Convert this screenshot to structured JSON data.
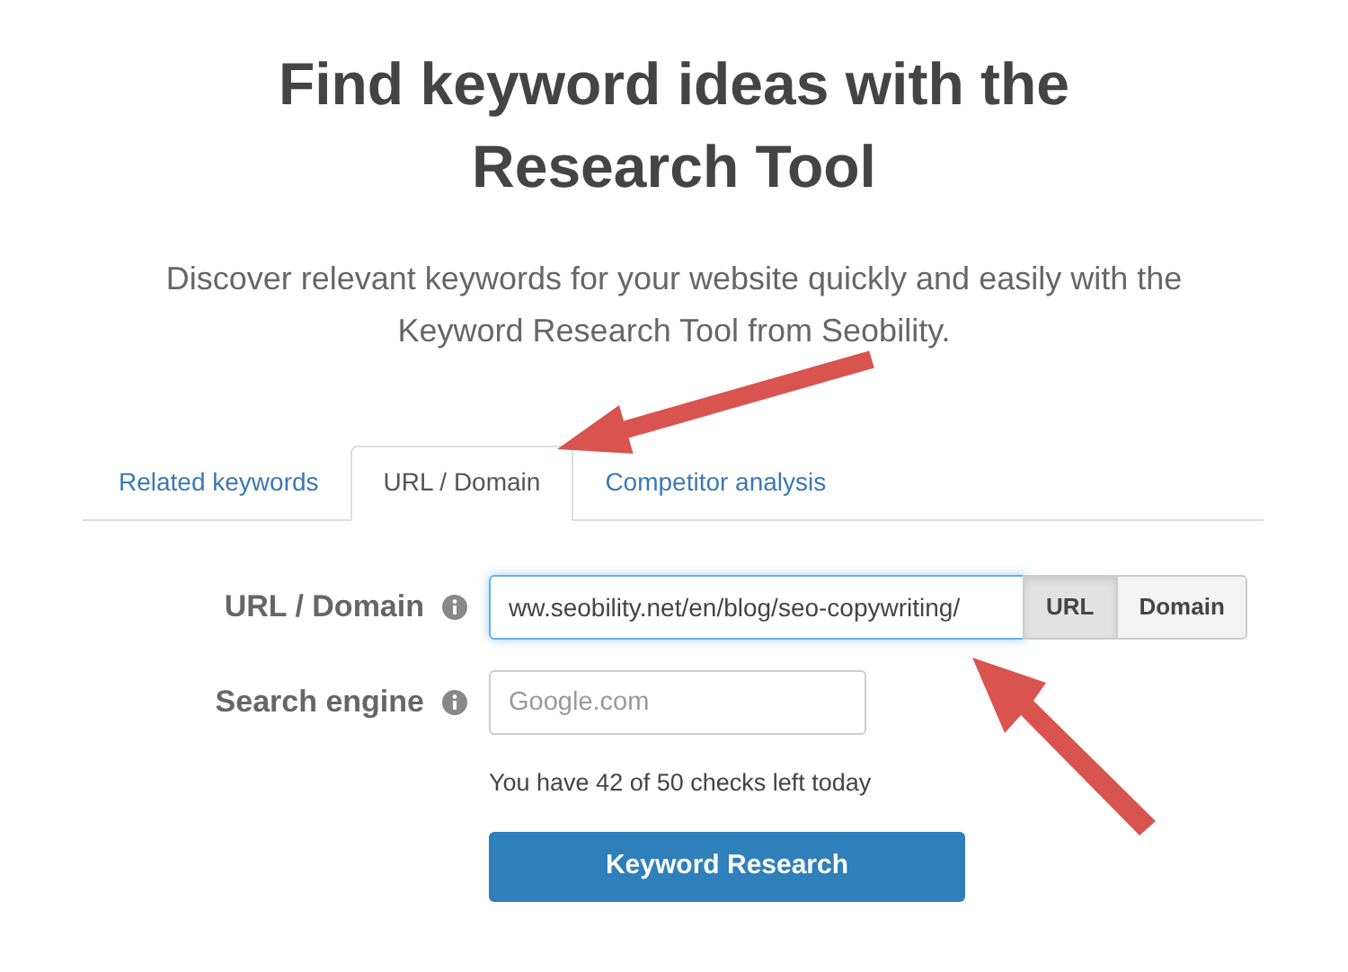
{
  "title": "Find keyword ideas with the Research Tool",
  "subtitle": "Discover relevant keywords for your website quickly and easily with the Keyword Research Tool from Seobility.",
  "tabs": [
    {
      "label": "Related keywords",
      "selected": false
    },
    {
      "label": "URL / Domain",
      "selected": true
    },
    {
      "label": "Competitor analysis",
      "selected": false
    }
  ],
  "form": {
    "url_label": "URL / Domain",
    "url_value": "ww.seobility.net/en/blog/seo-copywriting/",
    "modes": [
      {
        "label": "URL",
        "selected": true
      },
      {
        "label": "Domain",
        "selected": false
      }
    ],
    "engine_label": "Search engine",
    "engine_placeholder": "Google.com",
    "checks_note": "You have 42 of 50 checks left today",
    "submit": "Keyword Research"
  }
}
